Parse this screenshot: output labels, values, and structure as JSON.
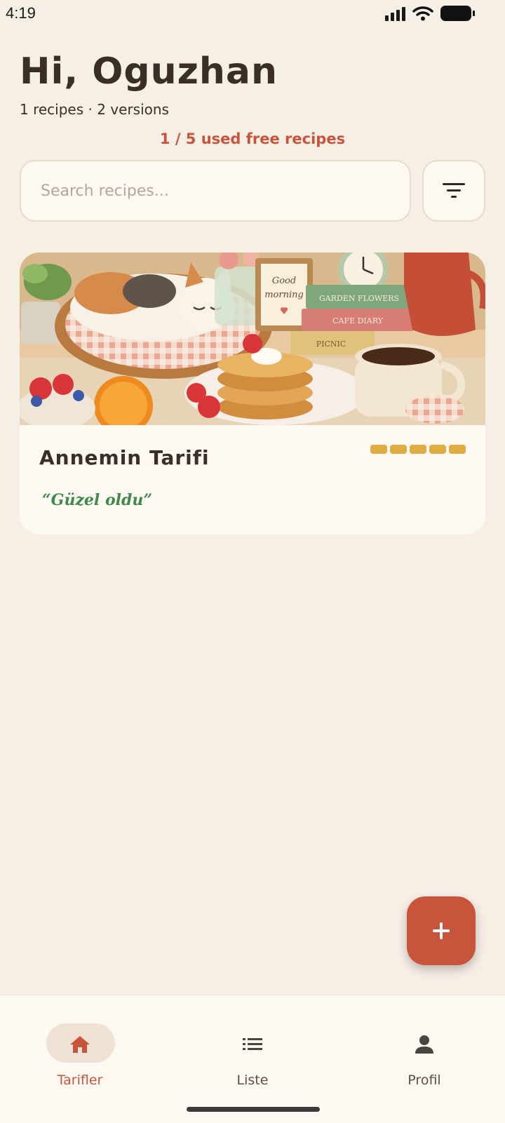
{
  "status_bar": {
    "time": "4:19"
  },
  "header": {
    "greeting": "Hi, Oguzhan",
    "stats": "1 recipes · 2 versions",
    "free_usage": "1 / 5 used free recipes"
  },
  "search": {
    "placeholder": "Search recipes...",
    "value": ""
  },
  "recipes": [
    {
      "title": "Annemin Tarifi",
      "note": "“Güzel oldu”",
      "rating": 5,
      "image_description": "illustrated breakfast table with sleeping calico cat, pancakes, coffee and books"
    }
  ],
  "image_text": {
    "frame": "Good morning",
    "book1": "GARDEN FLOWERS",
    "book2": "CAFE DIARY",
    "book3": "PICNIC"
  },
  "fab": {
    "icon": "plus-icon"
  },
  "bottom_nav": {
    "items": [
      {
        "label": "Tarifler",
        "icon": "home-icon",
        "active": true
      },
      {
        "label": "Liste",
        "icon": "list-icon",
        "active": false
      },
      {
        "label": "Profil",
        "icon": "person-icon",
        "active": false
      }
    ]
  },
  "colors": {
    "accent": "#c8553b",
    "background": "#f6efe6",
    "card": "#fdf9f2",
    "rating": "#e0ad44",
    "note": "#3f8a4a"
  }
}
